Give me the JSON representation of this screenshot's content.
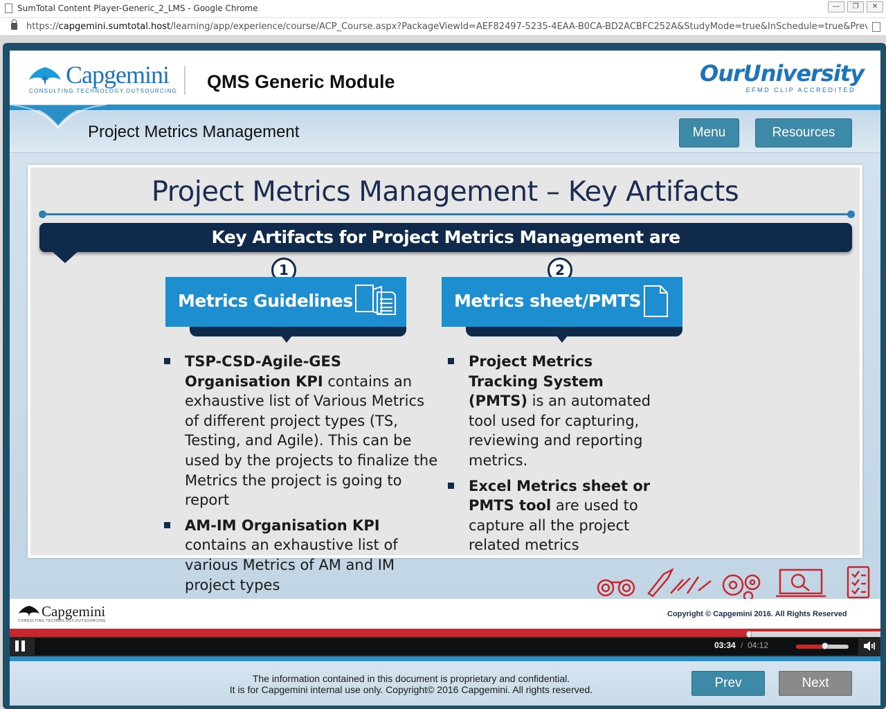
{
  "browser": {
    "window_title": "SumTotal Content Player-Generic_2_LMS - Google Chrome",
    "url_scheme": "https://",
    "url_host": "capgemini.sumtotal.host",
    "url_path": "/learning/app/experience/course/ACP_Course.aspx?PackageViewId=AEF82497-5235-4EAA-B0CA-BD2ACBFC252A&StudyMode=true&InSchedule=true&Preview..."
  },
  "header": {
    "logo_word": "Capgemini",
    "logo_tagline": "CONSULTING.TECHNOLOGY.OUTSOURCING",
    "module_title": "QMS Generic Module",
    "partner_logo": "OurUniversity",
    "partner_sub": "EFMD CLIP ACCREDITED"
  },
  "subheader": {
    "lesson_title": "Project Metrics Management",
    "menu_label": "Menu",
    "resources_label": "Resources"
  },
  "slide": {
    "title": "Project Metrics Management – Key Artifacts",
    "banner": "Key Artifacts for Project Metrics Management are",
    "cards": [
      {
        "number": "1",
        "label": "Metrics Guidelines",
        "icon": "document-book-icon",
        "bullets": [
          {
            "strong": "TSP-CSD-Agile-GES Organisation KPI",
            "text": " contains an exhaustive list of Various Metrics of different project types (TS, Testing, and Agile). This can be used by the projects to finalize the Metrics the project is going to report"
          },
          {
            "strong": "AM-IM Organisation KPI",
            "text": " contains an exhaustive list of various Metrics of AM and IM project types"
          }
        ]
      },
      {
        "number": "2",
        "label": "Metrics sheet/PMTS",
        "icon": "blank-document-icon",
        "bullets": [
          {
            "strong": "Project Metrics Tracking System (PMTS)",
            "text": " is an automated tool used for capturing, reviewing and reporting metrics."
          },
          {
            "strong": "Excel Metrics sheet or PMTS tool",
            "text": " are used to capture all the project related metrics"
          }
        ]
      }
    ]
  },
  "footer": {
    "logo_word": "Capgemini",
    "logo_tagline": "CONSULTING.TECHNOLOGY.OUTSOURCING",
    "copyright": "Copyright © Capgemini 2016. All Rights Reserved"
  },
  "player": {
    "current_time": "03:34",
    "separator": "/",
    "total_time": "04:12",
    "progress_fraction": 0.849,
    "volume_fraction": 0.55,
    "accent_color": "#c8282d"
  },
  "bottom": {
    "disclaimer_line1": "The information contained in this document is proprietary and confidential.",
    "disclaimer_line2": "It is for Capgemini internal use only. Copyright© 2016 Capgemini. All rights reserved.",
    "prev_label": "Prev",
    "next_label": "Next"
  }
}
